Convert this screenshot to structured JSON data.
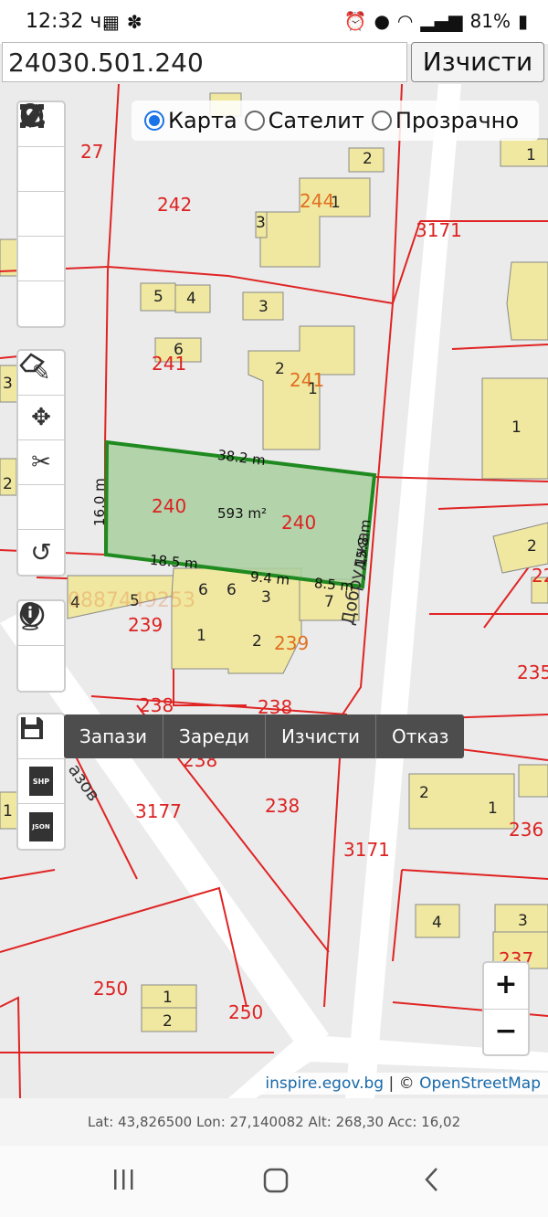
{
  "status_bar": {
    "time": "12:32 ч.",
    "battery": "81%"
  },
  "search": {
    "value": "24030.501.240",
    "clear_label": "Изчисти"
  },
  "layers": {
    "options": [
      "Карта",
      "Сателит",
      "Прозрачно"
    ],
    "selected": "Карта"
  },
  "map": {
    "parcel_labels": [
      "27",
      "242",
      "244",
      "3171",
      "241",
      "241",
      "240",
      "240",
      "239",
      "239",
      "238",
      "238",
      "238",
      "238",
      "3177",
      "3171",
      "235",
      "236",
      "237",
      "250",
      "250",
      "22"
    ],
    "building_numbers": [
      "2",
      "1",
      "3",
      "5",
      "4",
      "3",
      "6",
      "2",
      "1",
      "1",
      "4",
      "5",
      "6",
      "6",
      "3",
      "7",
      "1",
      "2",
      "2",
      "2",
      "1",
      "2",
      "1",
      "4",
      "3",
      "1",
      "2",
      "1",
      "3"
    ],
    "street_names": [
      "Добруджа",
      "азов"
    ],
    "phone_watermark": "0887449253",
    "measurements": {
      "top": "38.2 m",
      "left": "16.0 m",
      "right": "15.8 m",
      "bottom_a": "18.5 m",
      "bottom_b": "9.4 m",
      "bottom_c": "8.5 m",
      "area": "593 m²"
    },
    "colors": {
      "parcel_line": "#e02424",
      "building_fill": "#f0e8a0",
      "selected_fill": "#a9cfa0",
      "selected_stroke": "#1f8a1f"
    }
  },
  "save_menu": {
    "items": [
      "Запази",
      "Зареди",
      "Изчисти",
      "Отказ"
    ]
  },
  "file_icons": {
    "shp": "SHP",
    "json": "JSON"
  },
  "zoom": {
    "plus": "+",
    "minus": "−"
  },
  "attribution": {
    "source": "inspire.egov.bg",
    "separator": " | © ",
    "osm": "OpenStreetMap"
  },
  "coordinates": {
    "text": "Lat: 43,826500 Lon: 27,140082 Alt: 268,30 Acc: 16,02"
  }
}
